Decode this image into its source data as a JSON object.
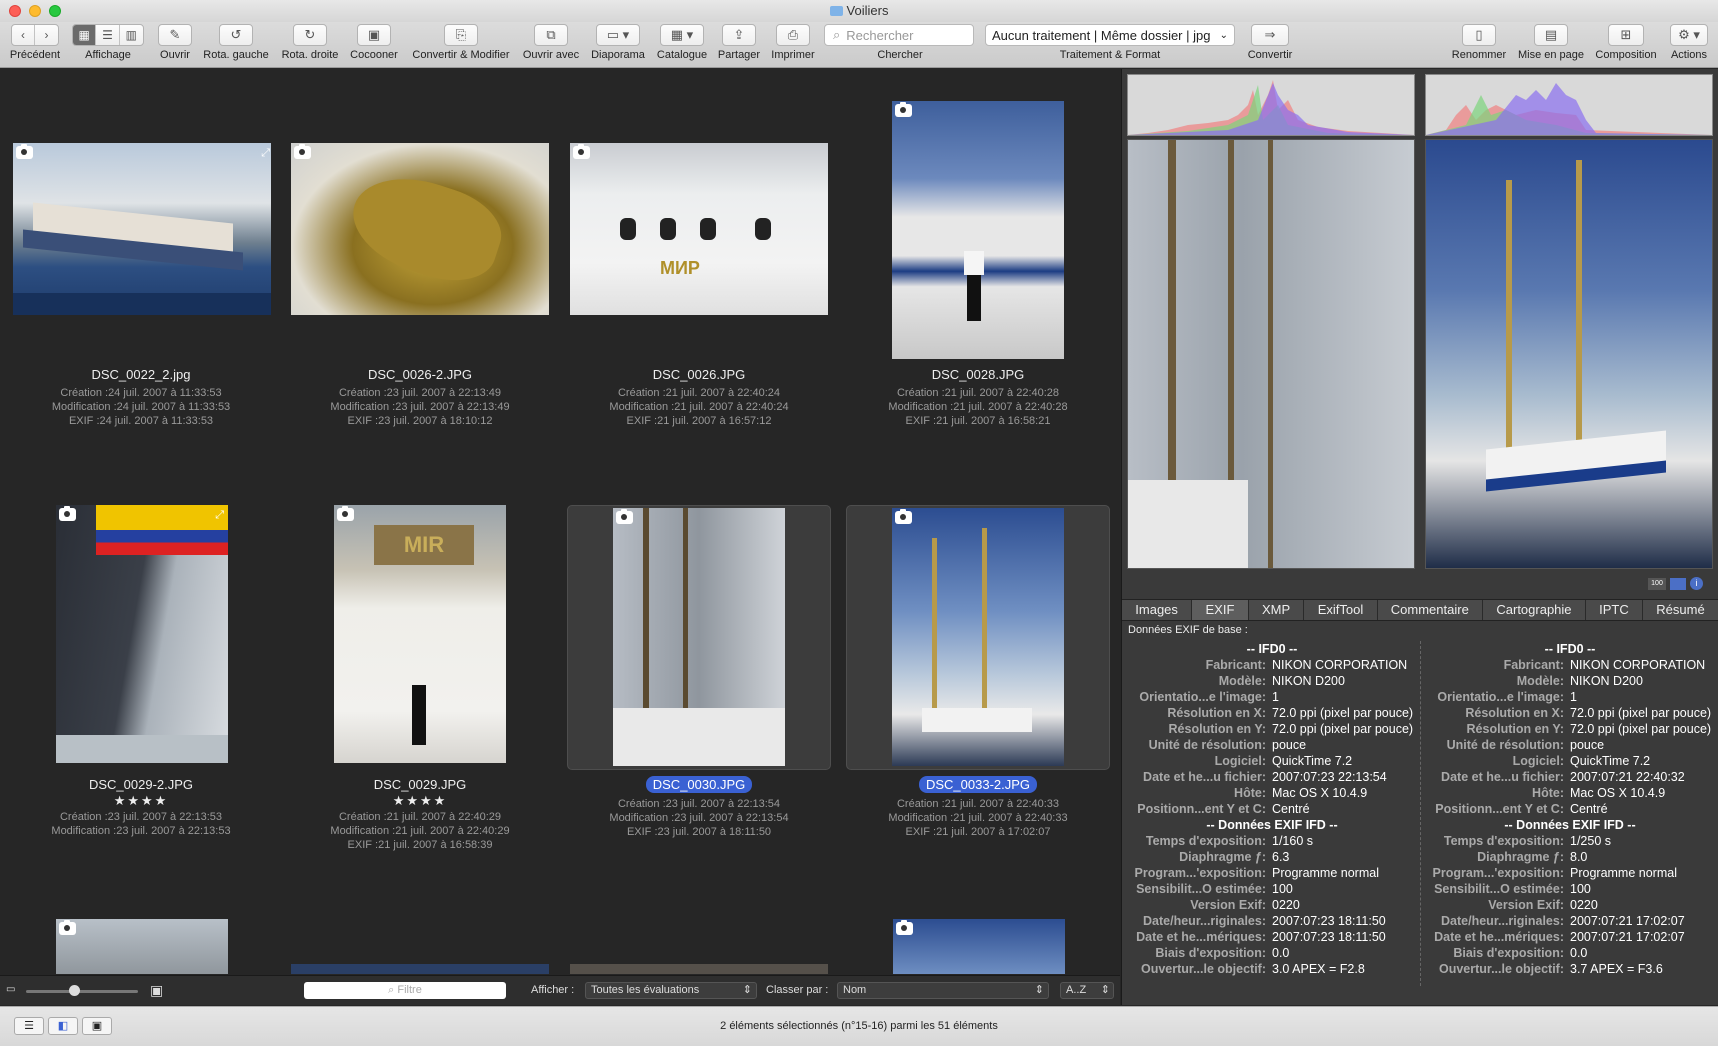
{
  "window": {
    "title": "Voiliers"
  },
  "toolbar": {
    "back_label": "Précédent",
    "view_label": "Affichage",
    "open_label": "Ouvrir",
    "rot_left_label": "Rota. gauche",
    "rot_right_label": "Rota. droite",
    "cocoon_label": "Cocooner",
    "convert_modify_label": "Convertir & Modifier",
    "open_with_label": "Ouvrir avec",
    "slideshow_label": "Diaporama",
    "catalog_label": "Catalogue",
    "share_label": "Partager",
    "print_label": "Imprimer",
    "search_placeholder": "Rechercher",
    "search_label": "Chercher",
    "process_value": "Aucun traitement | Même dossier | jpg",
    "process_label": "Traitement & Format",
    "convert_label": "Convertir",
    "rename_label": "Renommer",
    "layout_label": "Mise en page",
    "composition_label": "Composition",
    "actions_label": "Actions"
  },
  "thumbnails": [
    {
      "name": "DSC_0022_2.jpg",
      "stars": "",
      "creation": "Création :24 juil. 2007 à 11:33:53",
      "modification": "Modification :24 juil. 2007 à 11:33:53",
      "exif": "EXIF :24 juil. 2007 à 11:33:53",
      "selected": false
    },
    {
      "name": "DSC_0026-2.JPG",
      "stars": "",
      "creation": "Création :23 juil. 2007 à 22:13:49",
      "modification": "Modification :23 juil. 2007 à 22:13:49",
      "exif": "EXIF :23 juil. 2007 à 18:10:12",
      "selected": false
    },
    {
      "name": "DSC_0026.JPG",
      "stars": "",
      "creation": "Création :21 juil. 2007 à 22:40:24",
      "modification": "Modification :21 juil. 2007 à 22:40:24",
      "exif": "EXIF :21 juil. 2007 à 16:57:12",
      "selected": false
    },
    {
      "name": "DSC_0028.JPG",
      "stars": "",
      "creation": "Création :21 juil. 2007 à 22:40:28",
      "modification": "Modification :21 juil. 2007 à 22:40:28",
      "exif": "EXIF :21 juil. 2007 à 16:58:21",
      "selected": false
    },
    {
      "name": "DSC_0029-2.JPG",
      "stars": "★★★★",
      "creation": "Création :23 juil. 2007 à 22:13:53",
      "modification": "Modification :23 juil. 2007 à 22:13:53",
      "exif": "",
      "selected": false
    },
    {
      "name": "DSC_0029.JPG",
      "stars": "★★★★",
      "creation": "Création :21 juil. 2007 à 22:40:29",
      "modification": "Modification :21 juil. 2007 à 22:40:29",
      "exif": "EXIF :21 juil. 2007 à 16:58:39",
      "selected": false
    },
    {
      "name": "DSC_0030.JPG",
      "stars": "",
      "creation": "Création :23 juil. 2007 à 22:13:54",
      "modification": "Modification :23 juil. 2007 à 22:13:54",
      "exif": "EXIF :23 juil. 2007 à 18:11:50",
      "selected": true
    },
    {
      "name": "DSC_0033-2.JPG",
      "stars": "",
      "creation": "Création :21 juil. 2007 à 22:40:33",
      "modification": "Modification :21 juil. 2007 à 22:40:33",
      "exif": "EXIF :21 juil. 2007 à 17:02:07",
      "selected": true
    }
  ],
  "gridbar": {
    "filter_placeholder": "Filtre",
    "show_label": "Afficher :",
    "show_value": "Toutes les évaluations",
    "sort_label": "Classer par :",
    "sort_value": "Nom",
    "order_value": "A..Z"
  },
  "panel": {
    "tabs": [
      "Images",
      "EXIF",
      "XMP",
      "ExifTool",
      "Commentaire",
      "Cartographie",
      "IPTC",
      "Résumé"
    ],
    "active_tab": "EXIF",
    "exif_header": "Données EXIF de base :",
    "exif_columns": [
      {
        "section1": "-- IFD0 --",
        "section2": "-- Données EXIF IFD --",
        "rows1": [
          {
            "k": "Fabricant:",
            "v": "NIKON CORPORATION"
          },
          {
            "k": "Modèle:",
            "v": "NIKON D200"
          },
          {
            "k": "Orientatio...e l'image:",
            "v": "1"
          },
          {
            "k": "Résolution en X:",
            "v": "72.0 ppi (pixel par pouce)"
          },
          {
            "k": "Résolution en Y:",
            "v": "72.0 ppi (pixel par pouce)"
          },
          {
            "k": "Unité de résolution:",
            "v": "pouce"
          },
          {
            "k": "Logiciel:",
            "v": "QuickTime 7.2"
          },
          {
            "k": "Date et he...u fichier:",
            "v": "2007:07:23 22:13:54"
          },
          {
            "k": "Hôte:",
            "v": "Mac OS X 10.4.9"
          },
          {
            "k": "Positionn...ent Y et C:",
            "v": "Centré"
          }
        ],
        "rows2": [
          {
            "k": "Temps d'exposition:",
            "v": "1/160 s"
          },
          {
            "k": "Diaphragme ƒ:",
            "v": "6.3"
          },
          {
            "k": "Program...'exposition:",
            "v": "Programme normal"
          },
          {
            "k": "Sensibilit...O estimée:",
            "v": "100"
          },
          {
            "k": "Version Exif:",
            "v": "0220"
          },
          {
            "k": "Date/heur...riginales:",
            "v": "2007:07:23 18:11:50"
          },
          {
            "k": "Date et he...mériques:",
            "v": "2007:07:23 18:11:50"
          },
          {
            "k": "Biais d'exposition:",
            "v": "0.0"
          },
          {
            "k": "Ouvertur...le objectif:",
            "v": "3.0 APEX = F2.8"
          }
        ]
      },
      {
        "section1": "-- IFD0 --",
        "section2": "-- Données EXIF IFD --",
        "rows1": [
          {
            "k": "Fabricant:",
            "v": "NIKON CORPORATION"
          },
          {
            "k": "Modèle:",
            "v": "NIKON D200"
          },
          {
            "k": "Orientatio...e l'image:",
            "v": "1"
          },
          {
            "k": "Résolution en X:",
            "v": "72.0 ppi (pixel par pouce)"
          },
          {
            "k": "Résolution en Y:",
            "v": "72.0 ppi (pixel par pouce)"
          },
          {
            "k": "Unité de résolution:",
            "v": "pouce"
          },
          {
            "k": "Logiciel:",
            "v": "QuickTime 7.2"
          },
          {
            "k": "Date et he...u fichier:",
            "v": "2007:07:21 22:40:32"
          },
          {
            "k": "Hôte:",
            "v": "Mac OS X 10.4.9"
          },
          {
            "k": "Positionn...ent Y et C:",
            "v": "Centré"
          }
        ],
        "rows2": [
          {
            "k": "Temps d'exposition:",
            "v": "1/250 s"
          },
          {
            "k": "Diaphragme ƒ:",
            "v": "8.0"
          },
          {
            "k": "Program...'exposition:",
            "v": "Programme normal"
          },
          {
            "k": "Sensibilit...O estimée:",
            "v": "100"
          },
          {
            "k": "Version Exif:",
            "v": "0220"
          },
          {
            "k": "Date/heur...riginales:",
            "v": "2007:07:21 17:02:07"
          },
          {
            "k": "Date et he...mériques:",
            "v": "2007:07:21 17:02:07"
          },
          {
            "k": "Biais d'exposition:",
            "v": "0.0"
          },
          {
            "k": "Ouvertur...le objectif:",
            "v": "3.7 APEX = F3.6"
          }
        ]
      }
    ]
  },
  "status": {
    "text": "2 éléments sélectionnés (n°15-16) parmi les 51 éléments"
  },
  "colors": {
    "selection": "#3a61d3",
    "grid_bg": "#262626",
    "panel_bg": "#3a3a3a"
  }
}
